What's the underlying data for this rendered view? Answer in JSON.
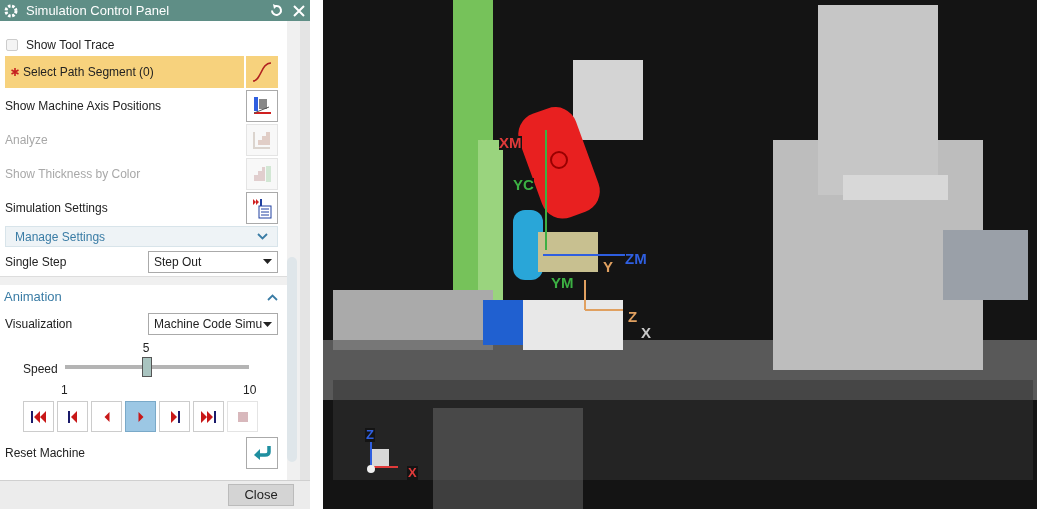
{
  "window": {
    "title": "Simulation Control Panel"
  },
  "options": [
    {
      "kind": "checkbox",
      "label": "Show Tool Trace",
      "checked": false
    },
    {
      "kind": "selection",
      "label": "Select Path Segment (0)",
      "required": true,
      "selected": true
    },
    {
      "kind": "action",
      "label": "Show Machine Axis Positions",
      "disabled": false
    },
    {
      "kind": "action",
      "label": "Analyze",
      "disabled": true
    },
    {
      "kind": "action",
      "label": "Show Thickness by Color",
      "disabled": true
    },
    {
      "kind": "action",
      "label": "Simulation Settings",
      "disabled": false
    }
  ],
  "manage_settings": {
    "label": "Manage Settings",
    "expanded": false
  },
  "single_step": {
    "label": "Single Step",
    "value": "Step Out"
  },
  "animation": {
    "title": "Animation",
    "expanded": true,
    "visualization": {
      "label": "Visualization",
      "value": "Machine Code Simu"
    },
    "speed": {
      "label": "Speed",
      "value": "5",
      "min": "1",
      "max": "10",
      "level": 0.444
    },
    "playback": [
      {
        "selected": false,
        "disabled": false
      },
      {
        "selected": false,
        "disabled": false
      },
      {
        "selected": false,
        "disabled": false
      },
      {
        "selected": true,
        "disabled": false
      },
      {
        "selected": false,
        "disabled": false
      },
      {
        "selected": false,
        "disabled": false
      },
      {
        "selected": false,
        "disabled": true
      }
    ],
    "reset": {
      "label": "Reset Machine"
    }
  },
  "footer_buttons": [
    "Close"
  ],
  "viewport": {
    "axis_labels": [
      {
        "text": "XM",
        "color": "#e03a3a"
      },
      {
        "text": "YC",
        "color": "#3cb043"
      },
      {
        "text": "ZM",
        "color": "#2f5fe0"
      },
      {
        "text": "YM",
        "color": "#3cb043"
      },
      {
        "text": "Y",
        "color": "#e0a060"
      },
      {
        "text": "Z",
        "color": "#e0a060"
      },
      {
        "text": "X",
        "color": "#c8c8c8"
      }
    ],
    "triad_labels": [
      {
        "text": "Z",
        "color": "#2f5fe0"
      },
      {
        "text": "X",
        "color": "#e03a3a"
      }
    ]
  }
}
